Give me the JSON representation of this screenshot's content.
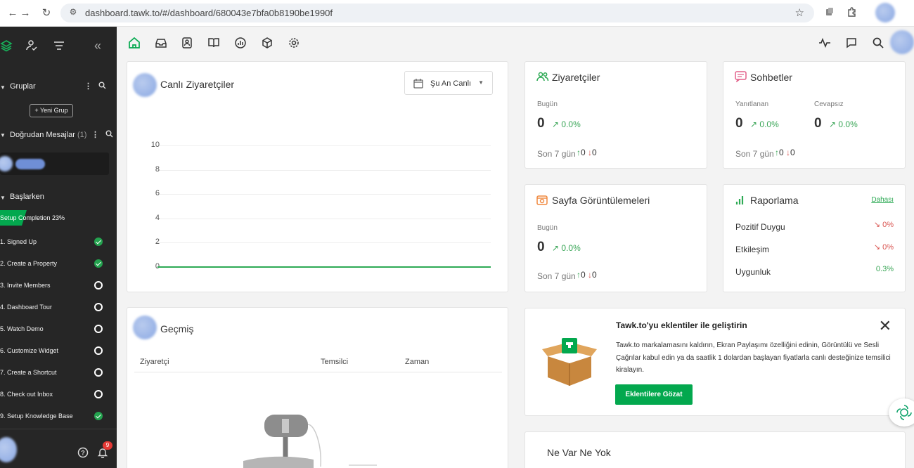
{
  "browser": {
    "url": "dashboard.tawk.to/#/dashboard/680043e7bfa0b8190be1990f",
    "icons": [
      "back-icon",
      "forward-icon",
      "reload-icon",
      "site-settings-icon",
      "bookmark-star-icon",
      "extension-icon",
      "puzzle-icon",
      "profile-avatar"
    ]
  },
  "sidebar": {
    "groups": {
      "title": "Gruplar",
      "new_group": "+ Yeni Grup"
    },
    "direct_messages": {
      "title": "Doğrudan Mesajlar",
      "count": "(1)"
    },
    "getting_started": {
      "title": "Başlarken",
      "progress_label": "Setup Completion 23%",
      "progress_percent": 23,
      "steps": [
        {
          "label": "1. Signed Up",
          "done": true
        },
        {
          "label": "2. Create a Property",
          "done": true
        },
        {
          "label": "3. Invite Members",
          "done": false
        },
        {
          "label": "4. Dashboard Tour",
          "done": false
        },
        {
          "label": "5. Watch Demo",
          "done": false
        },
        {
          "label": "6. Customize Widget",
          "done": false
        },
        {
          "label": "7. Create a Shortcut",
          "done": false
        },
        {
          "label": "8. Check out Inbox",
          "done": false
        },
        {
          "label": "9. Setup Knowledge Base",
          "done": true
        }
      ]
    },
    "notification_count": "9"
  },
  "live_visitors": {
    "title": "Canlı Ziyaretçiler",
    "filter": "Şu An Canlı",
    "chart_data": {
      "type": "line",
      "title": "",
      "xlabel": "",
      "ylabel": "",
      "y_ticks": [
        "10",
        "8",
        "6",
        "4",
        "2",
        "0"
      ],
      "ylim": [
        0,
        10
      ],
      "series": [
        {
          "values": [
            0,
            0
          ]
        }
      ]
    }
  },
  "history": {
    "title": "Geçmiş",
    "columns": [
      "Ziyaretçi",
      "Temsilci",
      "Zaman"
    ]
  },
  "visitors_card": {
    "title": "Ziyaretçiler",
    "today_label": "Bugün",
    "today_value": "0",
    "today_trend": "0.0%",
    "last7_label": "Son 7 gün",
    "up_value": "0",
    "down_value": "0"
  },
  "chats_card": {
    "title": "Sohbetler",
    "answered_label": "Yanıtlanan",
    "answered_value": "0",
    "answered_trend": "0.0%",
    "missed_label": "Cevapsız",
    "missed_value": "0",
    "missed_trend": "0.0%",
    "last7_label": "Son 7 gün",
    "up_value": "0",
    "down_value": "0"
  },
  "pageviews_card": {
    "title": "Sayfa Görüntülemeleri",
    "today_label": "Bugün",
    "today_value": "0",
    "today_trend": "0.0%",
    "last7_label": "Son 7 gün",
    "up_value": "0",
    "down_value": "0"
  },
  "reporting_card": {
    "title": "Raporlama",
    "more_link": "Dahası",
    "rows": [
      {
        "label": "Pozitif Duygu",
        "value": "0%",
        "direction": "down"
      },
      {
        "label": "Etkileşim",
        "value": "0%",
        "direction": "down"
      },
      {
        "label": "Uygunluk",
        "value": "0.3%",
        "direction": "none"
      }
    ]
  },
  "promo_card": {
    "title": "Tawk.to'yu eklentiler ile geliştirin",
    "body": "Tawk.to markalamasını kaldırın, Ekran Paylaşımı özelliğini edinin, Görüntülü ve Sesli Çağrılar kabul edin ya da saatlik 1 dolardan başlayan fiyatlarla canlı desteğinize temsilici kiralayın.",
    "button": "Eklentilere Gözat"
  },
  "news_card": {
    "title": "Ne Var Ne Yok"
  },
  "colors": {
    "brand_green": "#03a84e",
    "sidebar_bg": "#262626",
    "trend_up": "#3aa657",
    "trend_down": "#d9534f"
  }
}
